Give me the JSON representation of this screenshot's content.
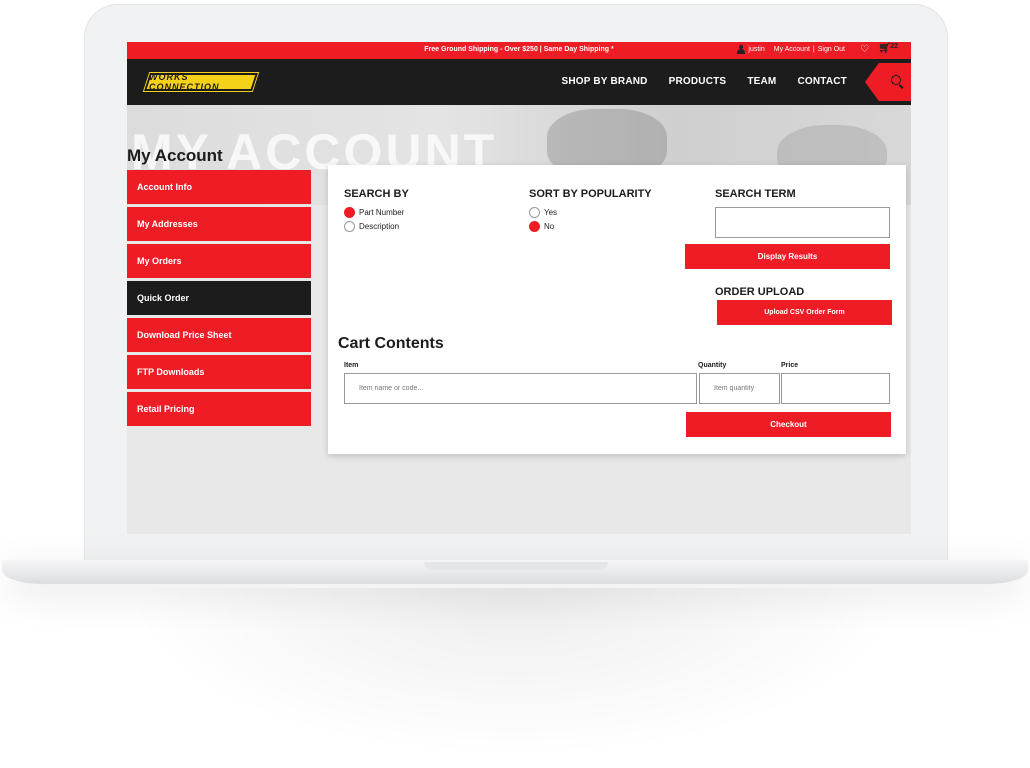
{
  "topbar": {
    "promo": "Free Ground Shipping - Over $250 | Same Day Shipping *",
    "username": "justin",
    "my_account": "My Account",
    "separator": "|",
    "sign_out": "Sign Out",
    "cart_count": "22"
  },
  "nav": {
    "logo": "WORKS CONNECTION",
    "links": [
      "SHOP BY BRAND",
      "PRODUCTS",
      "TEAM",
      "CONTACT"
    ]
  },
  "hero": {
    "bg_text": "MY ACCOUNT"
  },
  "page_title": "My Account",
  "sidebar": {
    "items": [
      {
        "label": "Account Info"
      },
      {
        "label": "My Addresses"
      },
      {
        "label": "My Orders"
      },
      {
        "label": "Quick Order"
      },
      {
        "label": "Download Price Sheet"
      },
      {
        "label": "FTP Downloads"
      },
      {
        "label": "Retail Pricing"
      }
    ]
  },
  "search": {
    "search_by_label": "SEARCH BY",
    "options": [
      "Part Number",
      "Description"
    ],
    "selected": "Part Number",
    "sort_label": "SORT BY POPULARITY",
    "sort_options": [
      "Yes",
      "No"
    ],
    "sort_selected": "No",
    "term_label": "SEARCH TERM",
    "term_value": "",
    "display_button": "Display Results"
  },
  "upload": {
    "label": "ORDER UPLOAD",
    "button": "Upload CSV Order Form"
  },
  "cart": {
    "title": "Cart Contents",
    "col_item": "Item",
    "col_quantity": "Quantity",
    "col_price": "Price",
    "item_placeholder": "Item name or code...",
    "quantity_placeholder": "Item quantity",
    "checkout_button": "Checkout"
  },
  "colors": {
    "accent": "#ee1c25",
    "dark": "#1c1c1c"
  },
  "icons": [
    "user-icon",
    "heart-icon",
    "cart-icon",
    "search-icon"
  ]
}
